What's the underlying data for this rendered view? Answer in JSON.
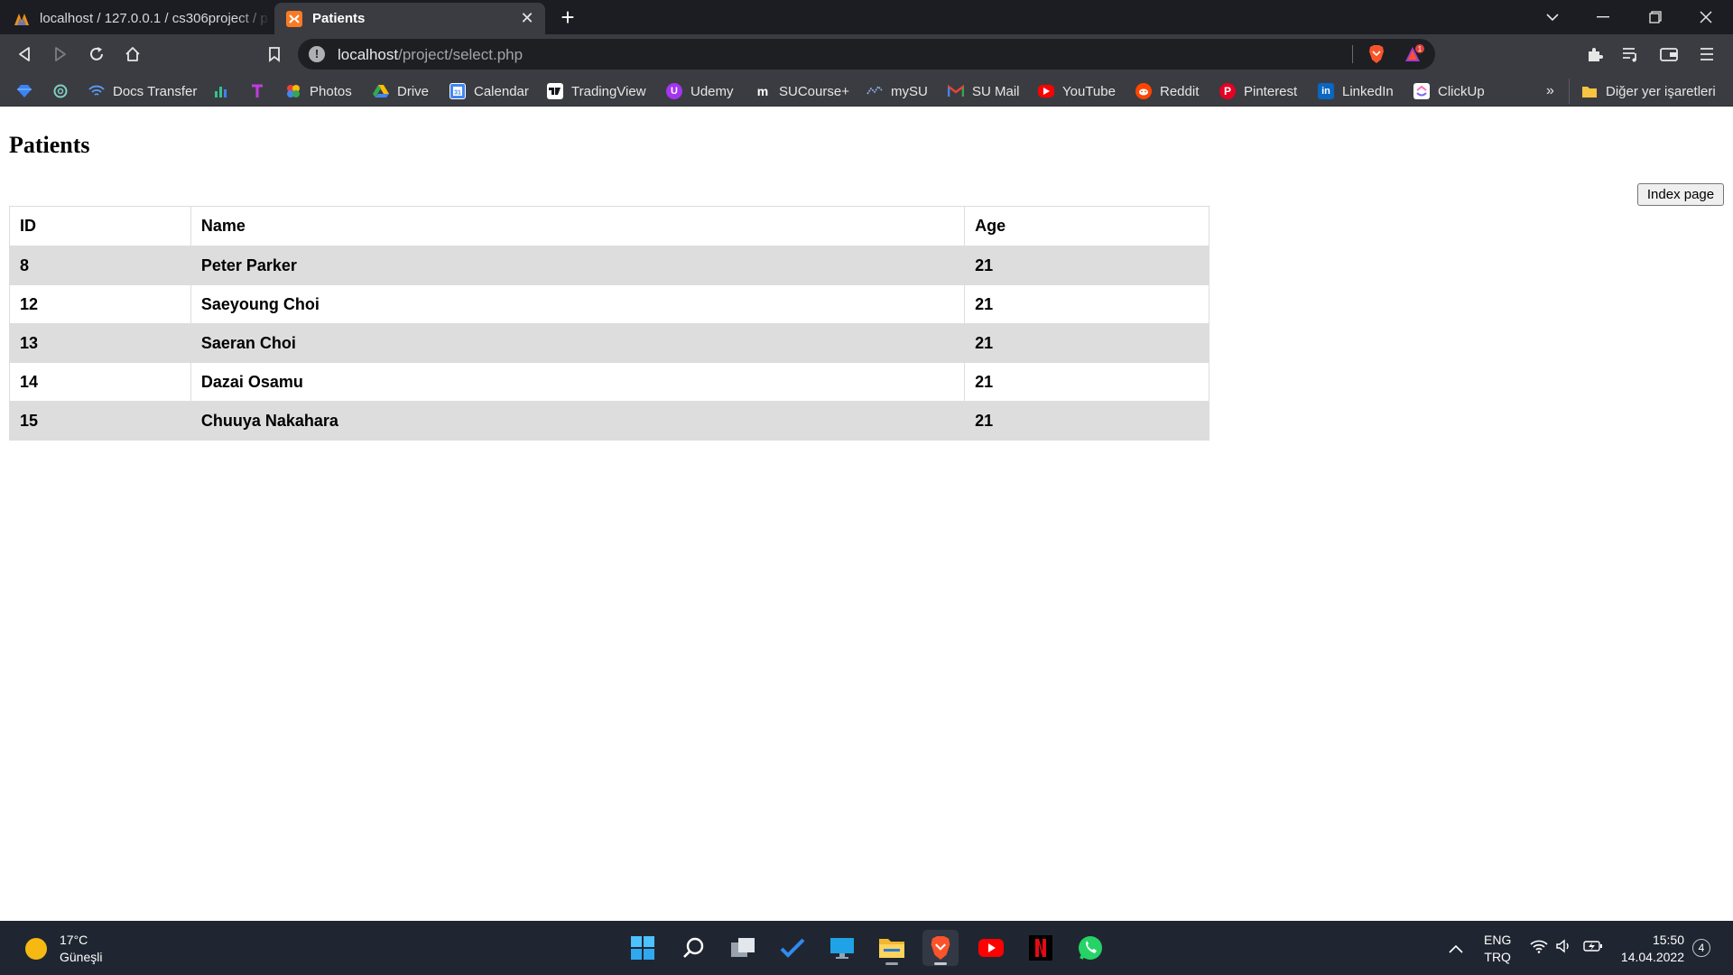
{
  "browser": {
    "tabs": [
      {
        "label": "localhost / 127.0.0.1 / cs306project / p",
        "active": false
      },
      {
        "label": "Patients",
        "active": true
      }
    ],
    "url_host": "localhost",
    "url_path": "/project/select.php",
    "brave_badge": "1"
  },
  "bookmarks": [
    {
      "label": "",
      "icon": "gem-icon"
    },
    {
      "label": "",
      "icon": "openai-icon"
    },
    {
      "label": "Docs Transfer",
      "icon": "wifi-icon"
    },
    {
      "label": "",
      "icon": "bar-chart-icon"
    },
    {
      "label": "",
      "icon": "t-logo-icon"
    },
    {
      "label": "Photos",
      "icon": "photos-icon"
    },
    {
      "label": "Drive",
      "icon": "drive-icon"
    },
    {
      "label": "Calendar",
      "icon": "calendar-icon"
    },
    {
      "label": "TradingView",
      "icon": "tradingview-icon"
    },
    {
      "label": "Udemy",
      "icon": "udemy-icon"
    },
    {
      "label": "SUCourse+",
      "icon": "moodle-icon"
    },
    {
      "label": "mySU",
      "icon": "mysu-icon"
    },
    {
      "label": "SU Mail",
      "icon": "gmail-icon"
    },
    {
      "label": "YouTube",
      "icon": "youtube-icon"
    },
    {
      "label": "Reddit",
      "icon": "reddit-icon"
    },
    {
      "label": "Pinterest",
      "icon": "pinterest-icon"
    },
    {
      "label": "LinkedIn",
      "icon": "linkedin-icon"
    },
    {
      "label": "ClickUp",
      "icon": "clickup-icon"
    }
  ],
  "bookmarks_more": "»",
  "other_bookmarks": "Diğer yer işaretleri",
  "page": {
    "title": "Patients",
    "index_button": "Index page",
    "table": {
      "headers": [
        "ID",
        "Name",
        "Age"
      ],
      "rows": [
        [
          "8",
          "Peter Parker",
          "21"
        ],
        [
          "12",
          "Saeyoung Choi",
          "21"
        ],
        [
          "13",
          "Saeran Choi",
          "21"
        ],
        [
          "14",
          "Dazai Osamu",
          "21"
        ],
        [
          "15",
          "Chuuya Nakahara",
          "21"
        ]
      ]
    }
  },
  "taskbar": {
    "weather_temp": "17°C",
    "weather_desc": "Güneşli",
    "lang_1": "ENG",
    "lang_2": "TRQ",
    "time": "15:50",
    "date": "14.04.2022",
    "notifications": "4"
  },
  "colors": {
    "tab_bar": "#1c1d22",
    "toolbar": "#3b3c42",
    "row_stripe": "#dddddd",
    "taskbar": "#202631",
    "brave_orange": "#fb542b"
  }
}
